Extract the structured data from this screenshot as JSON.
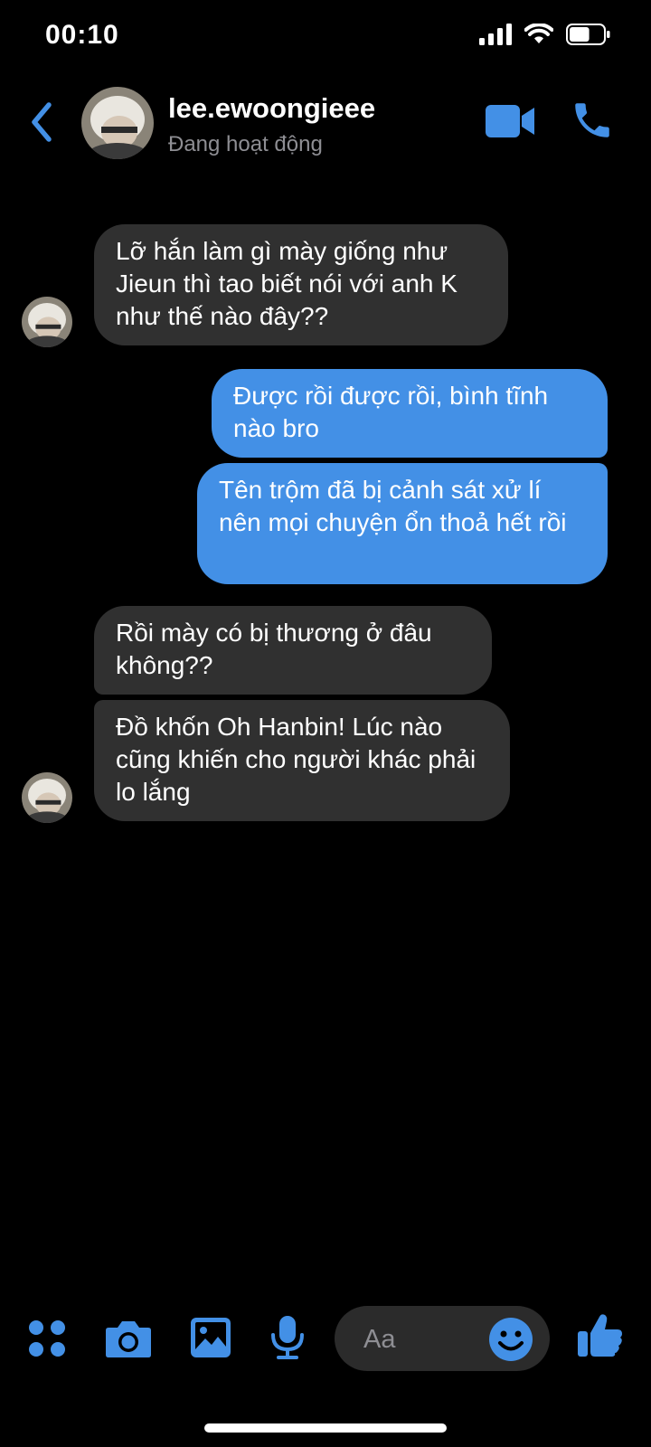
{
  "status_bar": {
    "time": "00:10",
    "battery_level": 0.6
  },
  "header": {
    "name": "lee.ewoongieee",
    "status": "Đang hoạt động",
    "accent": "#4390e6"
  },
  "messages": [
    {
      "sender": "contact",
      "text": "Lỡ hắn làm gì mày giống như Jieun thì tao biết nói với anh K như thế nào đây??"
    },
    {
      "sender": "me",
      "text": "Được rồi được rồi, bình tĩnh nào bro"
    },
    {
      "sender": "me",
      "text": "Tên trộm đã bị cảnh sát xử lí nên mọi chuyện ổn thoả hết rồi"
    },
    {
      "sender": "contact",
      "text": "Rồi mày có bị thương ở đâu không??"
    },
    {
      "sender": "contact",
      "text": "Đồ khốn Oh Hanbin! Lúc nào cũng khiến cho người khác phải lo lắng"
    }
  ],
  "composer": {
    "placeholder": "Aa"
  },
  "colors": {
    "incoming_bubble": "#303030",
    "outgoing_bubble": "#4390e6",
    "background": "#000000"
  }
}
